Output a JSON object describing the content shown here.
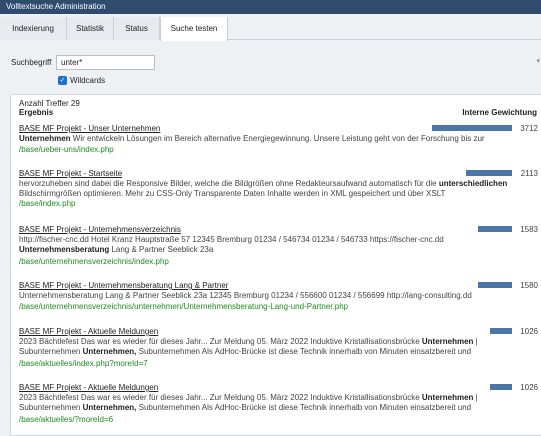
{
  "window": {
    "title": "Volltextsuche Administration"
  },
  "tabs": [
    {
      "label": "Indexierung"
    },
    {
      "label": "Statistik"
    },
    {
      "label": "Status"
    },
    {
      "label": "Suche testen"
    }
  ],
  "search": {
    "label": "Suchbegriff",
    "value": "unter*",
    "wildcards_label": "Wildcards",
    "wildcards_checked": true
  },
  "results": {
    "count_label": "Anzahl Treffer 29",
    "col_result": "Ergebnis",
    "col_weight": "Interne Gewichtung",
    "bar_color": "#4a77a6",
    "url_color": "#1f8a1f",
    "max_score": 3712,
    "items": [
      {
        "title": "BASE MF Projekt - Unser Unternehmen",
        "score": 3712,
        "snippet": [
          {
            "t": "Unternehmen",
            "b": true
          },
          {
            "t": " Wir entwickeln Lösungen im Bereich alternative Energiegewinnung. Unsere Leistung geht von der Forschung bis zur",
            "b": false
          }
        ],
        "url": "/base/ueber-uns/index.php"
      },
      {
        "title": "BASE MF Projekt - Startseite",
        "score": 2113,
        "snippet": [
          {
            "t": "hervorzuheben sind dabei die Responsive Bilder, welche die Bildgrößen ohne Redakteursaufwand automatisch für die ",
            "b": false
          },
          {
            "t": "unterschiedlichen",
            "b": true
          },
          {
            "t": " Bildschirmgrößen optimieren. Mehr zu CSS-Only Transparente Daten Inhalte werden in XML gespeichert und über XSLT",
            "b": false
          }
        ],
        "url": "/base/index.php"
      },
      {
        "title": "BASE MF Projekt - Unternehmensverzeichnis",
        "score": 1583,
        "snippet": [
          {
            "t": "http://fischer-cnc.dd Hotel Kranz Hauptstraße 57 12345 Bremburg 01234 / 546734 01234 / 546733 https://fischer-cnc.dd ",
            "b": false
          },
          {
            "t": "Unternehmensberatung",
            "b": true
          },
          {
            "t": " Lang & Partner Seeblick 23a",
            "b": false
          }
        ],
        "url": "/base/unternehmensverzeichnis/index.php"
      },
      {
        "title": "BASE MF Projekt - Unternehmensberatung Lang & Partner",
        "score": 1580,
        "snippet": [
          {
            "t": "Unternehmensberatung Lang & Partner Seeblick 23a 12345 Bremburg 01234 / 556600 01234 / 556699 http://lang-consulting.dd",
            "b": false
          }
        ],
        "url": "/base/unternehmensverzeichnis/unternehmen/Unternehmensberatung-Lang-und-Partner.php"
      },
      {
        "title": "BASE MF Projekt - Aktuelle Meldungen",
        "score": 1026,
        "snippet": [
          {
            "t": "2023 Bächtlefest Das war es wieder für dieses Jahr... Zur Meldung 05. März 2022 Induktive Kristallisationsbrücke ",
            "b": false
          },
          {
            "t": "Unternehmen",
            "b": true
          },
          {
            "t": " | Subunternehmen ",
            "b": false
          },
          {
            "t": "Unternehmen,",
            "b": true
          },
          {
            "t": " Subunternehmen Als AdHoc-Brücke ist diese Technik innerhalb von Minuten einsatzbereit und",
            "b": false
          }
        ],
        "url": "/base/aktuelles/index.php?moreId=7"
      },
      {
        "title": "BASE MF Projekt - Aktuelle Meldungen",
        "score": 1026,
        "snippet": [
          {
            "t": "2023 Bächtlefest Das war es wieder für dieses Jahr... Zur Meldung 05. März 2022 Induktive Kristallisationsbrücke ",
            "b": false
          },
          {
            "t": "Unternehmen",
            "b": true
          },
          {
            "t": " | Subunternehmen ",
            "b": false
          },
          {
            "t": "Unternehmen,",
            "b": true
          },
          {
            "t": " Subunternehmen Als AdHoc-Brücke ist diese Technik innerhalb von Minuten einsatzbereit und",
            "b": false
          }
        ],
        "url": "/base/aktuelles/?moreId=6"
      }
    ]
  }
}
